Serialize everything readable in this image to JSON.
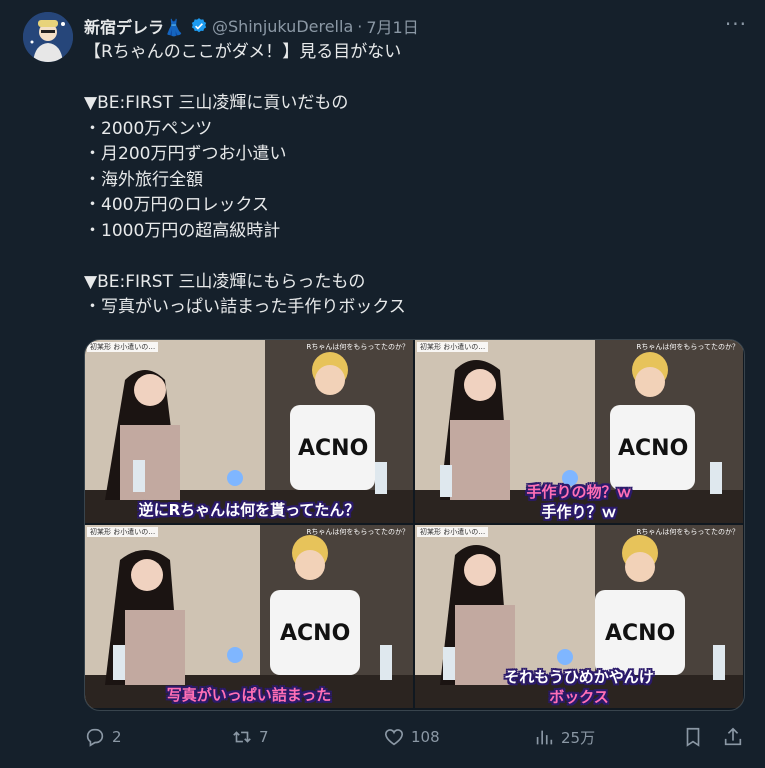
{
  "tweet": {
    "author_name": "新宿デレラ👗",
    "handle": "@ShinjukuDerella",
    "separator": "·",
    "date": "7月1日",
    "more_label": "···",
    "lines": [
      "【Rちゃんのここがダメ！】見る目がない",
      "",
      "▼BE:FIRST 三山凌輝に貢いだもの",
      "・2000万ペンツ",
      "・月200万円ずつお小遣い",
      "・海外旅行全額",
      "・400万円のロレックス",
      "・1000万円の超高級時計",
      "",
      "▼BE:FIRST 三山凌輝にもらったもの",
      "・写真がいっぱい詰まった手作りボックス"
    ]
  },
  "media": {
    "panels": [
      {
        "captions": [
          "逆にRちゃんは何を貰ってたん？"
        ]
      },
      {
        "captions": [
          "手作りの物？ｗ",
          "手作り？ｗ"
        ]
      },
      {
        "captions": [
          "写真がいっぱい詰まった"
        ]
      },
      {
        "captions": [
          "それもうひめかやんけ",
          "ボックス"
        ]
      }
    ],
    "top_tag": "Rちゃんは何をもらってたのか？"
  },
  "actions": {
    "reply_count": "2",
    "retweet_count": "7",
    "like_count": "108",
    "view_count": "25万"
  },
  "colors": {
    "background": "#15202b",
    "text": "#e7e9ea",
    "muted": "#8b98a5",
    "verified": "#1d9bf0"
  }
}
